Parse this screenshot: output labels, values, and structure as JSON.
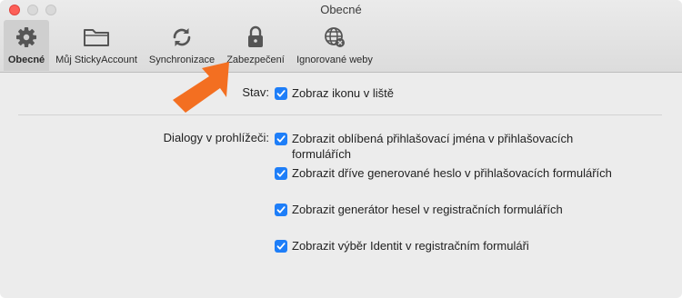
{
  "window": {
    "title": "Obecné"
  },
  "tabs": [
    {
      "label": "Obecné",
      "icon": "gear-icon",
      "active": true
    },
    {
      "label": "Můj StickyAccount",
      "icon": "folder-icon",
      "active": false
    },
    {
      "label": "Synchronizace",
      "icon": "sync-icon",
      "active": false
    },
    {
      "label": "Zabezpečení",
      "icon": "lock-icon",
      "active": false
    },
    {
      "label": "Ignorované weby",
      "icon": "globe-blocked-icon",
      "active": false
    }
  ],
  "status": {
    "label": "Stav:",
    "option": {
      "text": "Zobraz ikonu v liště",
      "checked": true
    }
  },
  "dialogs": {
    "label": "Dialogy v prohlížeči:",
    "options": [
      {
        "text": "Zobrazit oblíbená přihlašovací jména v přihlašovacích",
        "text2": "formulářích",
        "checked": true
      },
      {
        "text": "Zobrazit dříve generované heslo v přihlašovacích formulářích",
        "checked": true
      },
      {
        "text": "Zobrazit generátor hesel v registračních formulářích",
        "checked": true
      },
      {
        "text": "Zobrazit výběr Identit v registračním formuláři",
        "checked": true
      }
    ]
  },
  "colors": {
    "accent": "#1e7ef8",
    "highlight_arrow": "#f36f21"
  }
}
